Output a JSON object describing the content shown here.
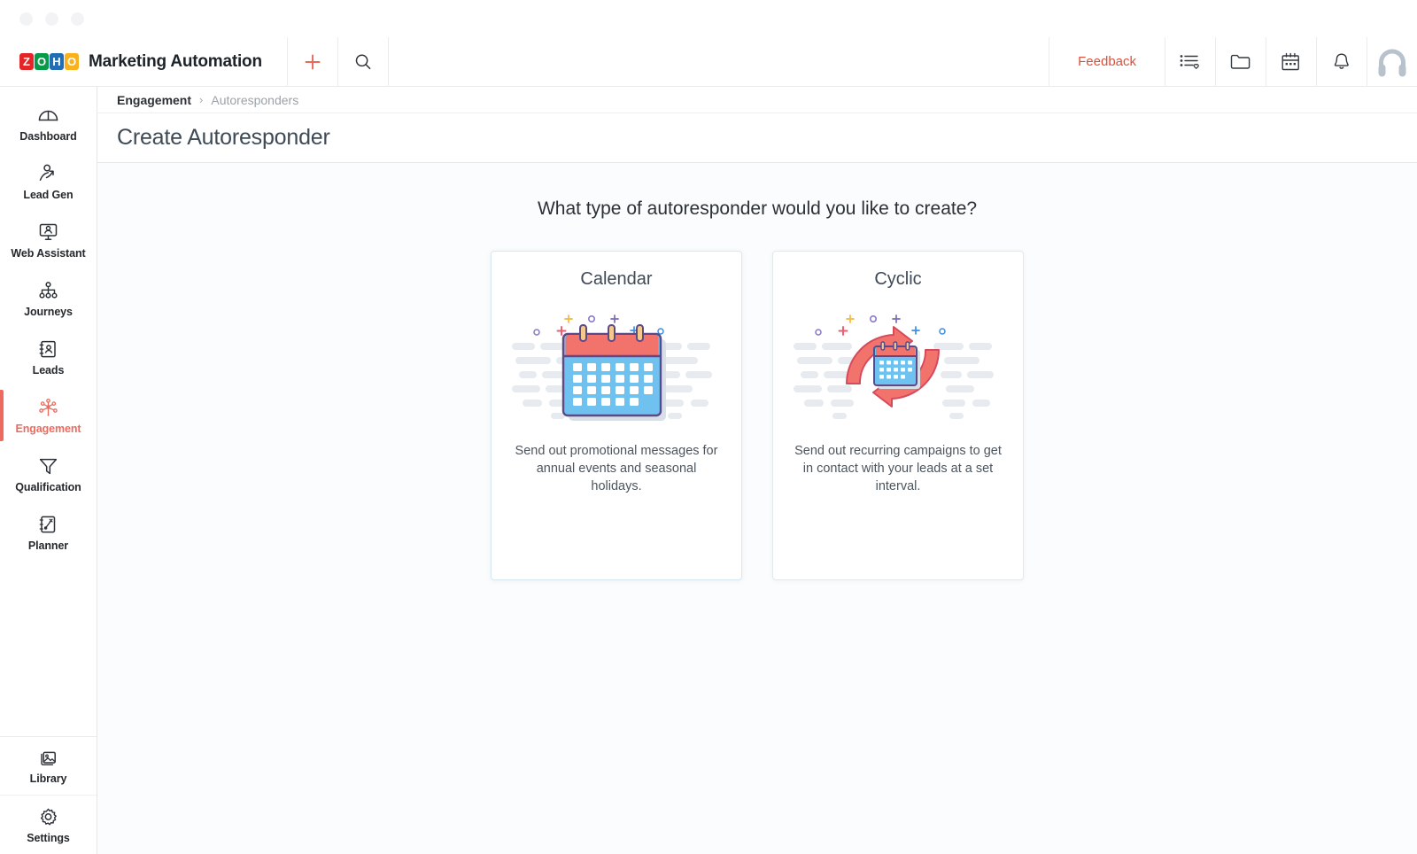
{
  "window": {
    "dots": [
      "dot-1",
      "dot-2",
      "dot-3"
    ]
  },
  "topbar": {
    "logo_letters": [
      "Z",
      "O",
      "H",
      "O"
    ],
    "app_title": "Marketing Automation",
    "add_icon": "plus-icon",
    "search_icon": "search-icon",
    "feedback_label": "Feedback",
    "icons": [
      {
        "name": "list-favorite-icon"
      },
      {
        "name": "folder-icon"
      },
      {
        "name": "calendar-icon"
      },
      {
        "name": "bell-icon"
      },
      {
        "name": "headset-support-icon"
      }
    ]
  },
  "sidebar": {
    "items": [
      {
        "label": "Dashboard",
        "icon": "speedometer-icon",
        "active": false
      },
      {
        "label": "Lead Gen",
        "icon": "lead-growth-icon",
        "active": false
      },
      {
        "label": "Web Assistant",
        "icon": "web-assistant-icon",
        "active": false
      },
      {
        "label": "Journeys",
        "icon": "hierarchy-icon",
        "active": false
      },
      {
        "label": "Leads",
        "icon": "contact-card-icon",
        "active": false
      },
      {
        "label": "Engagement",
        "icon": "engagement-icon",
        "active": true
      },
      {
        "label": "Qualification",
        "icon": "funnel-icon",
        "active": false
      },
      {
        "label": "Planner",
        "icon": "planner-icon",
        "active": false
      }
    ],
    "bottom_items": [
      {
        "label": "Library",
        "icon": "images-icon"
      },
      {
        "label": "Settings",
        "icon": "gear-icon"
      }
    ],
    "active_color": "#ec6b5e"
  },
  "breadcrumb": {
    "parent": "Engagement",
    "separator": "›",
    "current": "Autoresponders"
  },
  "page": {
    "title": "Create Autoresponder",
    "question": "What type of autoresponder would you like to create?"
  },
  "cards": [
    {
      "title": "Calendar",
      "description": "Send out promotional messages for annual events and seasonal holidays.",
      "art": "calendar-illustration"
    },
    {
      "title": "Cyclic",
      "description": "Send out recurring campaigns to get in contact with your leads at a set interval.",
      "art": "cyclic-calendar-illustration"
    }
  ],
  "colors": {
    "accent": "#ec6b5e",
    "feedback": "#e04e39",
    "calendar_header": "#f2736c",
    "calendar_body": "#6fc2ef",
    "illustration_outline": "#5a4a8a",
    "content_bg": "#fafcfd"
  }
}
